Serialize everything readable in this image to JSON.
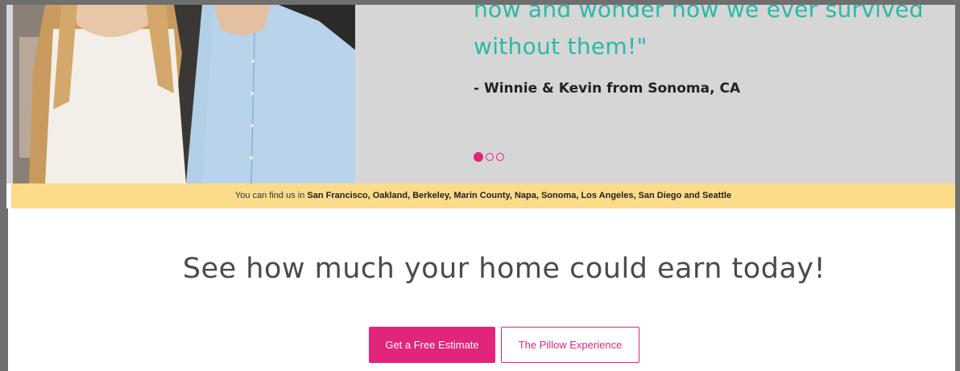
{
  "testimonial": {
    "quote_lines": [
      "now and wonder how we ever survived",
      "without them!\""
    ],
    "author": "- Winnie & Kevin from Sonoma, CA",
    "slide_count": 3,
    "active_slide": 1
  },
  "locations_bar": {
    "prefix": "You can find us in",
    "cities": "San Francisco, Oakland, Berkeley, Marin County, Napa, Sonoma, Los Angeles, San Diego and Seattle"
  },
  "cta": {
    "title": "See how much your home could earn today!",
    "primary_button": "Get a Free Estimate",
    "secondary_button": "The Pillow Experience"
  },
  "colors": {
    "accent": "#e0257a",
    "quote": "#2ab9a4",
    "locations_bg": "#fcdc8a",
    "hero_bg": "#d6d6d6"
  }
}
